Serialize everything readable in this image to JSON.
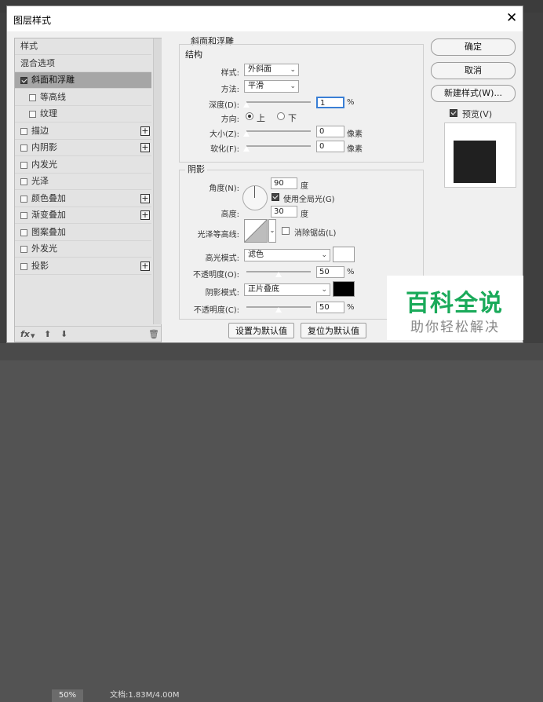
{
  "app": {
    "zoom": "50%",
    "doc_info": "文档:1.83M/4.00M"
  },
  "dialog": {
    "title": "图层样式",
    "close_icon": "close-icon"
  },
  "left_panel": {
    "items": [
      {
        "label": "样式",
        "checkbox": false,
        "plus": false,
        "selected": false
      },
      {
        "label": "混合选项",
        "checkbox": false,
        "plus": false,
        "selected": false
      },
      {
        "label": "斜面和浮雕",
        "checkbox": true,
        "checked": true,
        "plus": false,
        "selected": true
      },
      {
        "label": "等高线",
        "checkbox": true,
        "checked": false,
        "plus": false,
        "selected": false,
        "indent": true
      },
      {
        "label": "纹理",
        "checkbox": true,
        "checked": false,
        "plus": false,
        "selected": false,
        "indent": true
      },
      {
        "label": "描边",
        "checkbox": true,
        "checked": false,
        "plus": true,
        "selected": false
      },
      {
        "label": "内阴影",
        "checkbox": true,
        "checked": false,
        "plus": true,
        "selected": false
      },
      {
        "label": "内发光",
        "checkbox": true,
        "checked": false,
        "plus": false,
        "selected": false
      },
      {
        "label": "光泽",
        "checkbox": true,
        "checked": false,
        "plus": false,
        "selected": false
      },
      {
        "label": "颜色叠加",
        "checkbox": true,
        "checked": false,
        "plus": true,
        "selected": false
      },
      {
        "label": "渐变叠加",
        "checkbox": true,
        "checked": false,
        "plus": true,
        "selected": false
      },
      {
        "label": "图案叠加",
        "checkbox": true,
        "checked": false,
        "plus": false,
        "selected": false
      },
      {
        "label": "外发光",
        "checkbox": true,
        "checked": false,
        "plus": false,
        "selected": false
      },
      {
        "label": "投影",
        "checkbox": true,
        "checked": false,
        "plus": true,
        "selected": false
      }
    ],
    "fx_label": "fx",
    "plus_symbol": "+"
  },
  "bevel": {
    "section_title": "斜面和浮雕",
    "structure_title": "结构",
    "style_label": "样式:",
    "style_value": "外斜面",
    "technique_label": "方法:",
    "technique_value": "平滑",
    "depth_label": "深度(D):",
    "depth_value": "1",
    "depth_unit": "%",
    "depth_level": 0,
    "direction_label": "方向:",
    "direction_up": "上",
    "direction_down": "下",
    "size_label": "大小(Z):",
    "size_value": "0",
    "size_unit": "像素",
    "size_level": 0,
    "soften_label": "软化(F):",
    "soften_value": "0",
    "soften_unit": "像素",
    "soften_level": 0
  },
  "shading": {
    "title": "阴影",
    "angle_label": "角度(N):",
    "angle_value": "90",
    "angle_unit": "度",
    "global_light_label": "使用全局光(G)",
    "altitude_label": "高度:",
    "altitude_value": "30",
    "altitude_unit": "度",
    "gloss_label": "光泽等高线:",
    "antialias_label": "消除锯齿(L)",
    "highlight_label": "高光模式:",
    "highlight_value": "滤色",
    "highlight_color": "#ffffff",
    "hl_opacity_label": "不透明度(O):",
    "hl_opacity_value": "50",
    "hl_opacity_unit": "%",
    "hl_opacity_level": 0.5,
    "shadow_label": "阴影模式:",
    "shadow_value": "正片叠底",
    "shadow_color": "#000000",
    "sh_opacity_label": "不透明度(C):",
    "sh_opacity_value": "50",
    "sh_opacity_unit": "%",
    "sh_opacity_level": 0.5,
    "make_default": "设置为默认值",
    "reset_default": "复位为默认值"
  },
  "right": {
    "ok": "确定",
    "cancel": "取消",
    "new_style": "新建样式(W)...",
    "preview_label": "预览(V)",
    "preview_color": "#202020"
  },
  "watermark": {
    "line1": "百科全说",
    "line2": "助你轻松解决"
  }
}
